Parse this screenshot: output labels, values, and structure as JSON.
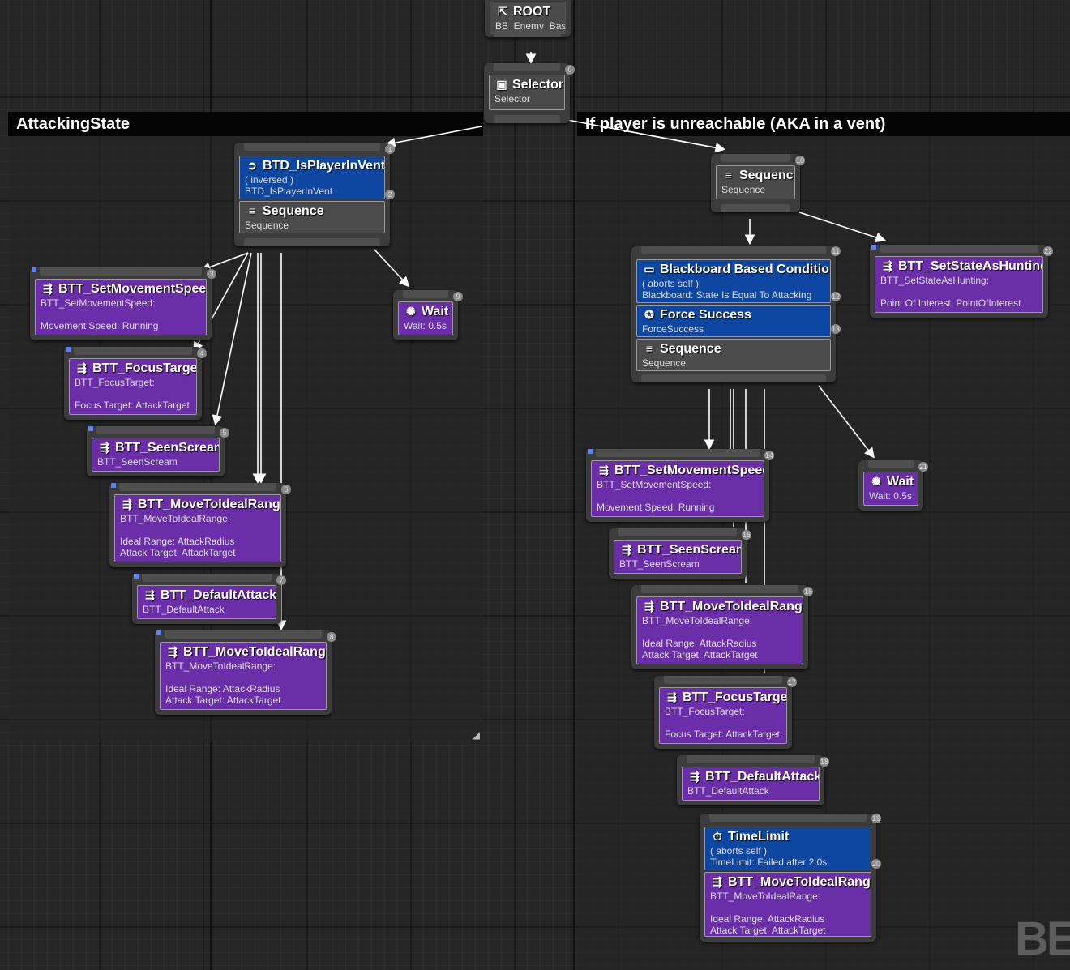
{
  "comments": {
    "left": "AttackingState",
    "right": "If player is unreachable (AKA in a vent)"
  },
  "root": {
    "title": "ROOT",
    "sub": "BB_Enemy_Base",
    "icon": "root-icon"
  },
  "selector": {
    "title": "Selector",
    "sub": "Selector",
    "index": "0",
    "icon": "selector-icon"
  },
  "left_seq": {
    "decorator": {
      "title": "BTD_IsPlayerInVent",
      "line1": "( inversed )",
      "line2": "BTD_IsPlayerInVent",
      "index": "1",
      "icon": "decorator-icon"
    },
    "sequence": {
      "title": "Sequence",
      "sub": "Sequence",
      "index": "2"
    }
  },
  "left_tasks": [
    {
      "title": "BTT_SetMovementSpeed",
      "l1": "BTT_SetMovementSpeed:",
      "l2": "",
      "l3": "Movement Speed: Running",
      "index": "3"
    },
    {
      "title": "BTT_FocusTarget",
      "l1": "BTT_FocusTarget:",
      "l2": "",
      "l3": "Focus Target: AttackTarget",
      "index": "4"
    },
    {
      "title": "BTT_SeenScream",
      "l1": "BTT_SeenScream",
      "index": "5"
    },
    {
      "title": "BTT_MoveToIdealRange",
      "l1": "BTT_MoveToIdealRange:",
      "l2": "",
      "l3": "Ideal Range: AttackRadius",
      "l4": "Attack Target: AttackTarget",
      "index": "6"
    },
    {
      "title": "BTT_DefaultAttack",
      "l1": "BTT_DefaultAttack",
      "index": "7"
    },
    {
      "title": "BTT_MoveToIdealRange",
      "l1": "BTT_MoveToIdealRange:",
      "l2": "",
      "l3": "Ideal Range: AttackRadius",
      "l4": "Attack Target: AttackTarget",
      "index": "8"
    }
  ],
  "left_wait": {
    "title": "Wait",
    "sub": "Wait: 0.5s",
    "index": "9"
  },
  "right_seq": {
    "title": "Sequence",
    "sub": "Sequence",
    "index": "10"
  },
  "bb_node": {
    "bb": {
      "title": "Blackboard Based Condition",
      "line1": "( aborts self )",
      "line2": "Blackboard: State Is Equal To Attacking",
      "index": "11"
    },
    "fs": {
      "title": "Force Success",
      "line1": "ForceSuccess",
      "index": "12"
    },
    "seq": {
      "title": "Sequence",
      "sub": "Sequence",
      "index": "13"
    }
  },
  "hunting": {
    "title": "BTT_SetStateAsHunting",
    "l1": "BTT_SetStateAsHunting:",
    "l2": "",
    "l3": "Point Of Interest: PointOfInterest",
    "index": "22"
  },
  "right_wait": {
    "title": "Wait",
    "sub": "Wait: 0.5s",
    "index": "21"
  },
  "right_tasks": [
    {
      "title": "BTT_SetMovementSpeed",
      "l1": "BTT_SetMovementSpeed:",
      "l2": "",
      "l3": "Movement Speed: Running",
      "index": "14"
    },
    {
      "title": "BTT_SeenScream",
      "l1": "BTT_SeenScream",
      "index": "15"
    },
    {
      "title": "BTT_MoveToIdealRange",
      "l1": "BTT_MoveToIdealRange:",
      "l2": "",
      "l3": "Ideal Range: AttackRadius",
      "l4": "Attack Target: AttackTarget",
      "index": "16"
    },
    {
      "title": "BTT_FocusTarget",
      "l1": "BTT_FocusTarget:",
      "l2": "",
      "l3": "Focus Target: AttackTarget",
      "index": "17"
    },
    {
      "title": "BTT_DefaultAttack",
      "l1": "BTT_DefaultAttack",
      "index": "18"
    }
  ],
  "timelimit": {
    "dec": {
      "title": "TimeLimit",
      "line1": "( aborts self )",
      "line2": "TimeLimit: Failed after 2.0s",
      "index": "19"
    },
    "task": {
      "title": "BTT_MoveToIdealRange",
      "l1": "BTT_MoveToIdealRange:",
      "l2": "",
      "l3": "Ideal Range: AttackRadius",
      "l4": "Attack Target: AttackTarget",
      "index": "20"
    }
  },
  "watermark": "BE",
  "colors": {
    "task": "#6a2ea8",
    "decorator": "#0d47a1",
    "composite": "#4b4b4b",
    "background": "#262626"
  }
}
